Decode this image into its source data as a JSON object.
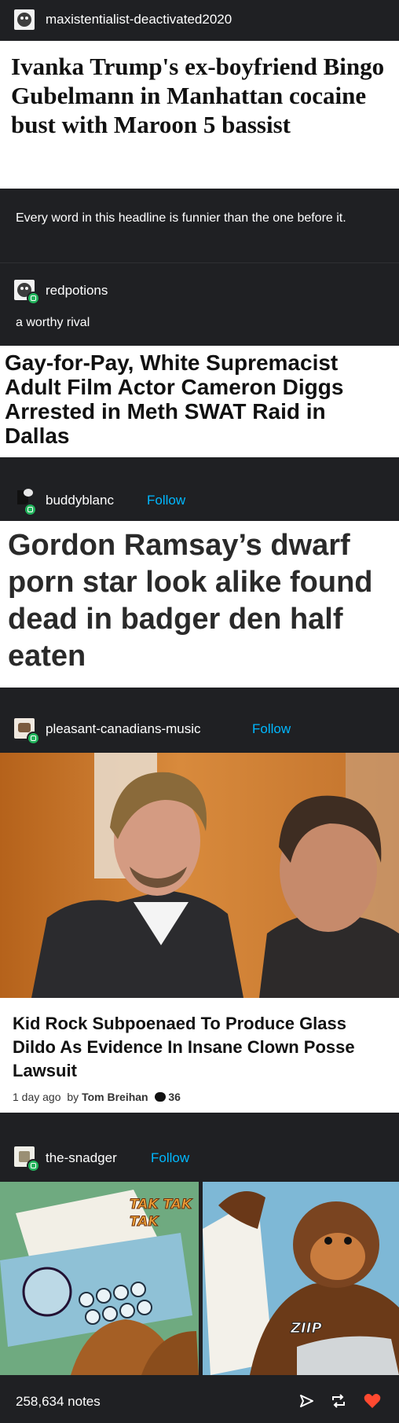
{
  "post1": {
    "username": "maxistentialist-deactivated2020",
    "headline": "Ivanka Trump's ex-boyfriend Bingo Gubelmann in Manhattan cocaine bust with Maroon 5 bassist",
    "comment": "Every word in this headline is funnier than the one before it."
  },
  "post2": {
    "username": "redpotions",
    "comment": "a worthy rival",
    "headline": "Gay-for-Pay, White Supremacist Adult Film Actor Cameron Diggs Arrested in Meth SWAT Raid in Dallas"
  },
  "post3": {
    "username": "buddyblanc",
    "follow": "Follow",
    "headline": "Gordon Ramsay’s dwarf porn star look alike found dead in badger den half eaten"
  },
  "post4": {
    "username": "pleasant-canadians-music",
    "follow": "Follow",
    "headline": "Kid Rock Subpoenaed To Produce Glass Dildo As Evidence In Insane Clown Posse Lawsuit",
    "time": "1 day ago",
    "by": "by",
    "author": "Tom Breihan",
    "comments": "36"
  },
  "post5": {
    "username": "the-snadger",
    "follow": "Follow",
    "sfx1": "TAK TAK TAK",
    "sfx2": "ZIIP"
  },
  "footer": {
    "notes": "258,634 notes"
  },
  "colors": {
    "background": "#1f2023",
    "follow": "#00b8ff",
    "like": "#ff4930",
    "badge": "#21b35b"
  }
}
